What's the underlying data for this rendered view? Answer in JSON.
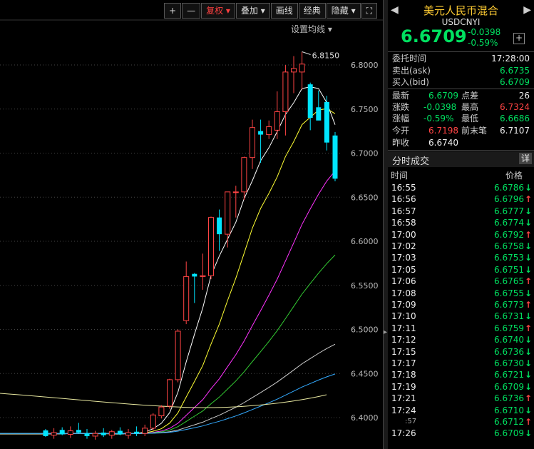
{
  "toolbar": {
    "items": [
      "+",
      "—",
      "复权 ▾",
      "叠加 ▾",
      "画线",
      "经典",
      "隐藏 ▾",
      "⛶"
    ],
    "set_ma": "设置均线 ▾"
  },
  "chart_data": {
    "type": "candlestick",
    "y_ticks": [
      "6.8000",
      "6.7500",
      "6.7000",
      "6.6500",
      "6.6000",
      "6.5500",
      "6.5000",
      "6.4500",
      "6.4000"
    ],
    "ylim": [
      6.38,
      6.84
    ],
    "high_marker": "6.8150",
    "candles": [
      {
        "o": 6.3855,
        "h": 6.387,
        "l": 6.378,
        "c": 6.379
      },
      {
        "o": 6.38,
        "h": 6.388,
        "l": 6.376,
        "c": 6.383
      },
      {
        "o": 6.386,
        "h": 6.389,
        "l": 6.38,
        "c": 6.381
      },
      {
        "o": 6.381,
        "h": 6.39,
        "l": 6.377,
        "c": 6.385
      },
      {
        "o": 6.386,
        "h": 6.394,
        "l": 6.382,
        "c": 6.383
      },
      {
        "o": 6.382,
        "h": 6.387,
        "l": 6.376,
        "c": 6.379
      },
      {
        "o": 6.379,
        "h": 6.385,
        "l": 6.375,
        "c": 6.382
      },
      {
        "o": 6.383,
        "h": 6.388,
        "l": 6.378,
        "c": 6.38
      },
      {
        "o": 6.38,
        "h": 6.386,
        "l": 6.376,
        "c": 6.384
      },
      {
        "o": 6.385,
        "h": 6.389,
        "l": 6.38,
        "c": 6.381
      },
      {
        "o": 6.38,
        "h": 6.387,
        "l": 6.376,
        "c": 6.383
      },
      {
        "o": 6.384,
        "h": 6.39,
        "l": 6.379,
        "c": 6.382
      },
      {
        "o": 6.382,
        "h": 6.392,
        "l": 6.379,
        "c": 6.388
      },
      {
        "o": 6.388,
        "h": 6.405,
        "l": 6.385,
        "c": 6.403
      },
      {
        "o": 6.402,
        "h": 6.414,
        "l": 6.399,
        "c": 6.412
      },
      {
        "o": 6.413,
        "h": 6.444,
        "l": 6.41,
        "c": 6.443
      },
      {
        "o": 6.443,
        "h": 6.5,
        "l": 6.44,
        "c": 6.498
      },
      {
        "o": 6.51,
        "h": 6.577,
        "l": 6.506,
        "c": 6.56
      },
      {
        "o": 6.563,
        "h": 6.564,
        "l": 6.53,
        "c": 6.56
      },
      {
        "o": 6.56,
        "h": 6.586,
        "l": 6.545,
        "c": 6.561
      },
      {
        "o": 6.561,
        "h": 6.628,
        "l": 6.557,
        "c": 6.627
      },
      {
        "o": 6.627,
        "h": 6.636,
        "l": 6.589,
        "c": 6.608
      },
      {
        "o": 6.608,
        "h": 6.656,
        "l": 6.593,
        "c": 6.656
      },
      {
        "o": 6.656,
        "h": 6.663,
        "l": 6.627,
        "c": 6.656
      },
      {
        "o": 6.656,
        "h": 6.696,
        "l": 6.647,
        "c": 6.695
      },
      {
        "o": 6.695,
        "h": 6.738,
        "l": 6.682,
        "c": 6.729
      },
      {
        "o": 6.725,
        "h": 6.738,
        "l": 6.689,
        "c": 6.721
      },
      {
        "o": 6.721,
        "h": 6.737,
        "l": 6.716,
        "c": 6.73
      },
      {
        "o": 6.726,
        "h": 6.77,
        "l": 6.716,
        "c": 6.747
      },
      {
        "o": 6.747,
        "h": 6.8,
        "l": 6.72,
        "c": 6.792
      },
      {
        "o": 6.792,
        "h": 6.81,
        "l": 6.768,
        "c": 6.796
      },
      {
        "o": 6.792,
        "h": 6.815,
        "l": 6.772,
        "c": 6.801
      },
      {
        "o": 6.778,
        "h": 6.78,
        "l": 6.726,
        "c": 6.74
      },
      {
        "o": 6.752,
        "h": 6.771,
        "l": 6.742,
        "c": 6.737
      },
      {
        "o": 6.758,
        "h": 6.765,
        "l": 6.703,
        "c": 6.712
      },
      {
        "o": 6.72,
        "h": 6.724,
        "l": 6.668,
        "c": 6.671
      }
    ]
  },
  "panel": {
    "title": "美元人民币混合",
    "code": "USDCNYI",
    "price": "6.6709",
    "change": "-0.0398",
    "change_pct": "-0.59%",
    "order_time_label": "委托时间",
    "order_time": "17:28:00",
    "ask_label": "卖出(ask)",
    "ask": "6.6735",
    "bid_label": "买入(bid)",
    "bid": "6.6709",
    "latest_label": "最新",
    "latest": "6.6709",
    "spread_label": "点差",
    "spread": "26",
    "chg_label": "涨跌",
    "chg": "-0.0398",
    "high_label": "最高",
    "high": "6.7324",
    "pct_label": "涨幅",
    "pct": "-0.59%",
    "low_label": "最低",
    "low": "6.6686",
    "open_label": "今开",
    "open": "6.7198",
    "prev_close_label": "前末笔",
    "prev_close": "6.7107",
    "yclose_label": "昨收",
    "yclose": "6.6740",
    "trades_title": "分时成交",
    "detail_btn": "详",
    "col_time": "时间",
    "col_price": "价格",
    "trades": [
      {
        "t": "16:55",
        "p": "6.6786",
        "d": "down"
      },
      {
        "t": "16:56",
        "p": "6.6796",
        "d": "up"
      },
      {
        "t": "16:57",
        "p": "6.6777",
        "d": "down"
      },
      {
        "t": "16:58",
        "p": "6.6774",
        "d": "down"
      },
      {
        "t": "17:00",
        "p": "6.6792",
        "d": "up"
      },
      {
        "t": "17:02",
        "p": "6.6758",
        "d": "down"
      },
      {
        "t": "17:03",
        "p": "6.6753",
        "d": "down"
      },
      {
        "t": "17:05",
        "p": "6.6751",
        "d": "down"
      },
      {
        "t": "17:06",
        "p": "6.6765",
        "d": "up"
      },
      {
        "t": "17:08",
        "p": "6.6755",
        "d": "down"
      },
      {
        "t": "17:09",
        "p": "6.6773",
        "d": "up"
      },
      {
        "t": "17:10",
        "p": "6.6731",
        "d": "down"
      },
      {
        "t": "17:11",
        "p": "6.6759",
        "d": "up"
      },
      {
        "t": "17:12",
        "p": "6.6740",
        "d": "down"
      },
      {
        "t": "17:15",
        "p": "6.6736",
        "d": "down"
      },
      {
        "t": "17:17",
        "p": "6.6730",
        "d": "down"
      },
      {
        "t": "17:18",
        "p": "6.6721",
        "d": "down"
      },
      {
        "t": "17:19",
        "p": "6.6709",
        "d": "down"
      },
      {
        "t": "17:21",
        "p": "6.6736",
        "d": "up"
      },
      {
        "t": "17:24",
        "p": "6.6710",
        "d": "down"
      },
      {
        "t": ":57",
        "p": "6.6712",
        "d": "up"
      },
      {
        "t": "17:26",
        "p": "6.6709",
        "d": "down"
      }
    ],
    "colors": {
      "up": "#ff4444",
      "down": "#00e060",
      "cyan": "#00e5ff"
    }
  }
}
